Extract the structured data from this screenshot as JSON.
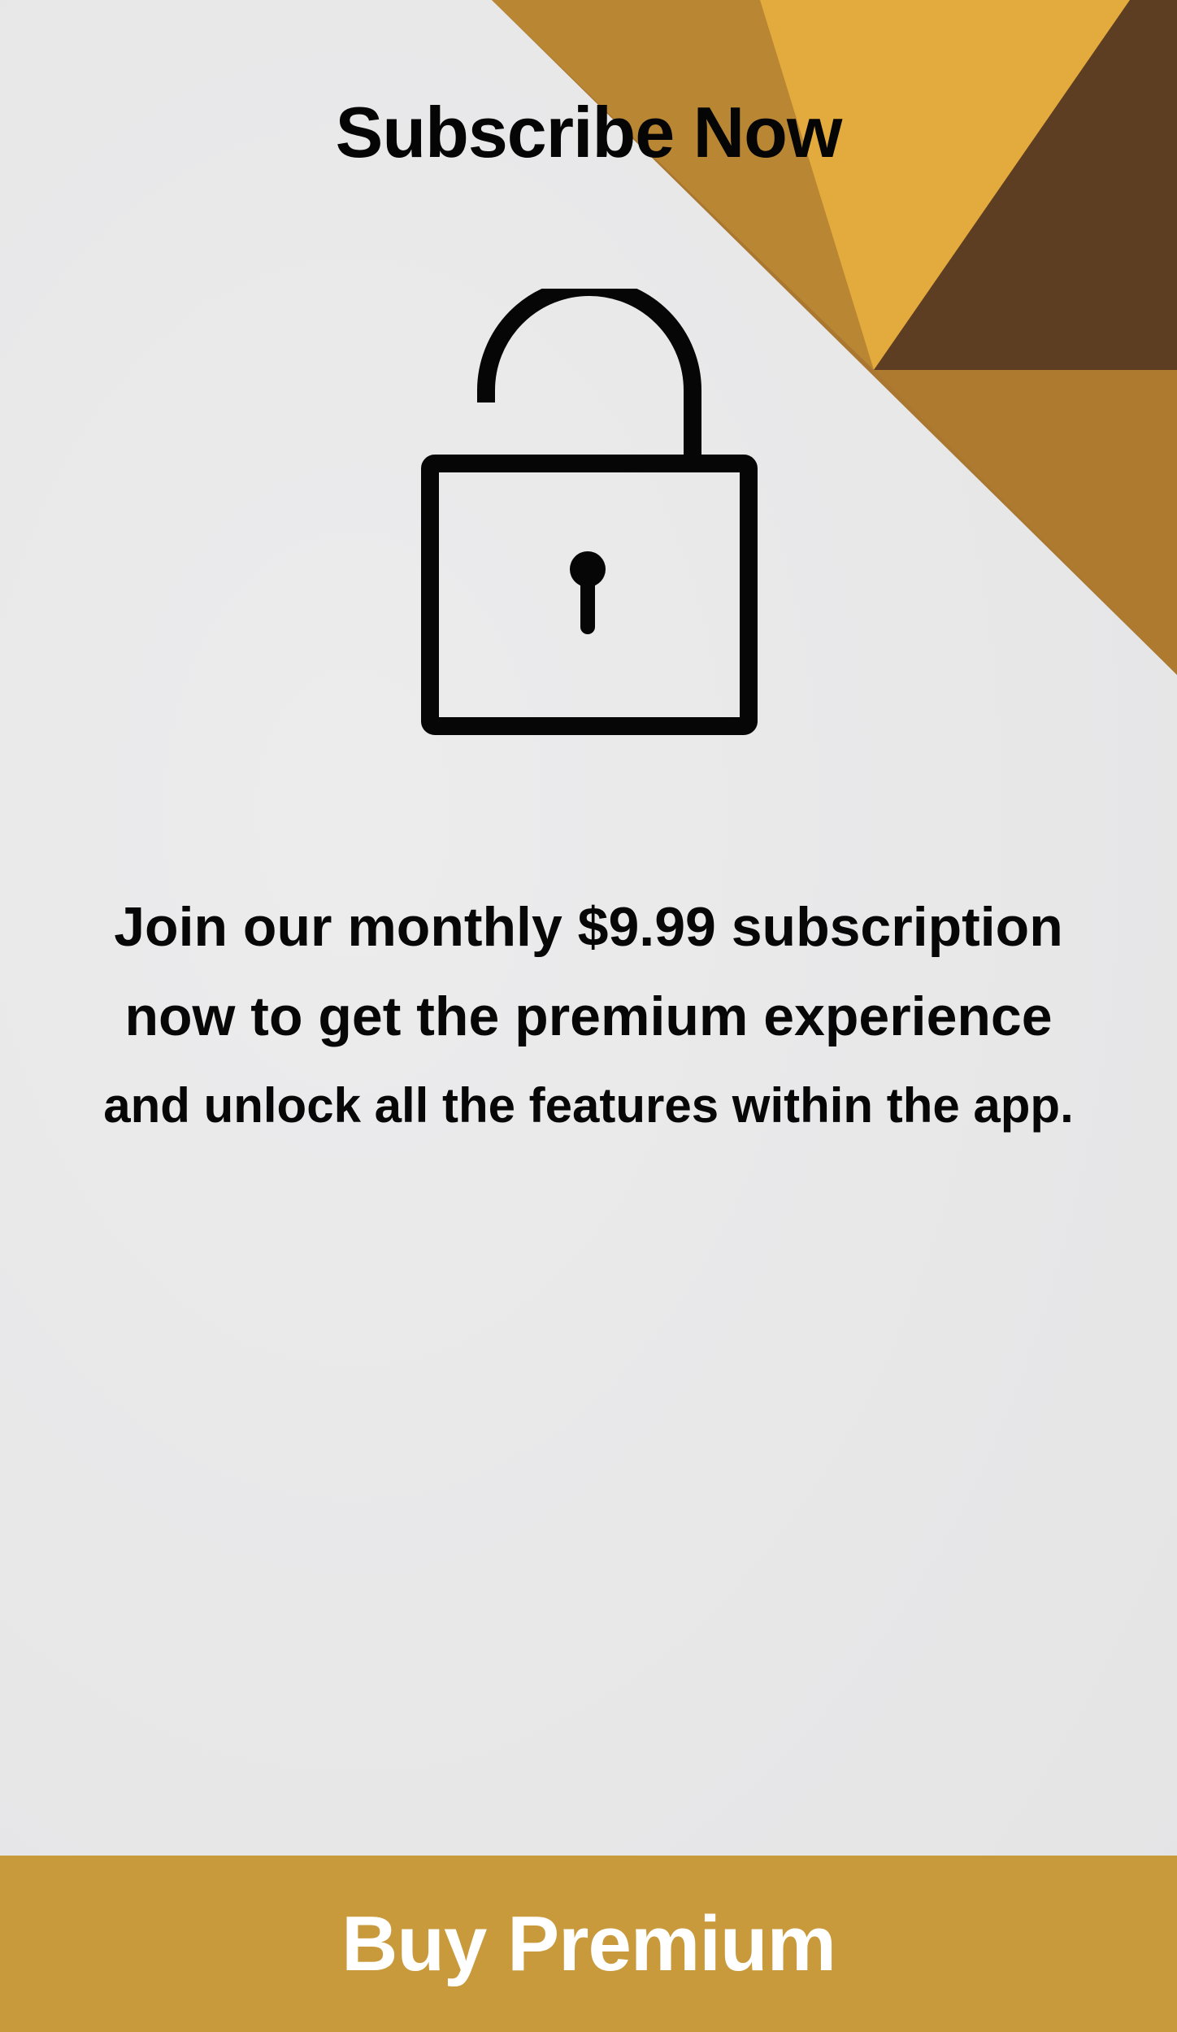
{
  "header": {
    "title": "Subscribe Now"
  },
  "hero": {
    "icon": "unlocked-padlock-icon"
  },
  "description": {
    "line_1": "Join our monthly $9.99 subscription",
    "line_2": "now to get the premium experience",
    "line_3": "and unlock all the features within the app."
  },
  "cta": {
    "label": "Buy Premium"
  },
  "colors": {
    "background": "#e9e9ea",
    "button": "#c99a3c",
    "button_text": "#ffffff",
    "text": "#050505",
    "accent_gold": "#e0a93c",
    "accent_dark": "#5a3c1e"
  }
}
